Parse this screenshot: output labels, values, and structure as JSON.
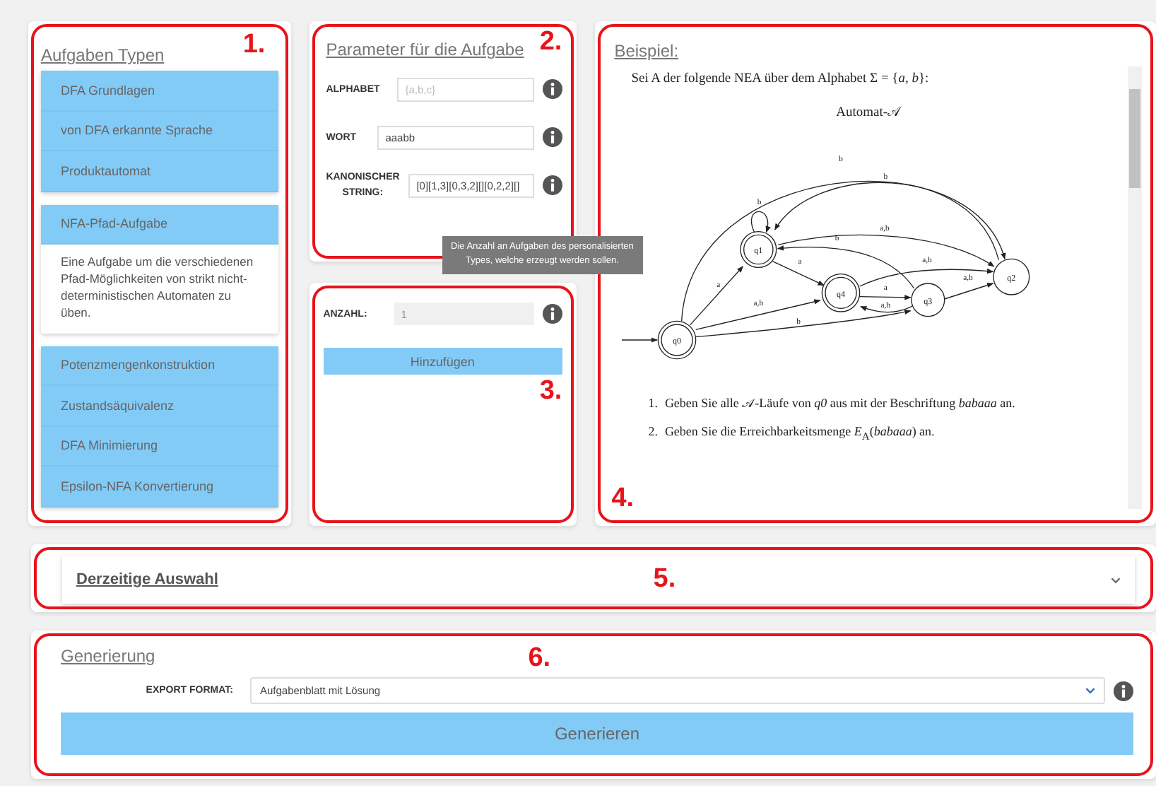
{
  "task_types": {
    "heading": "Aufgaben Typen",
    "annotation": "1.",
    "groups": [
      {
        "items": [
          {
            "label": "DFA Grundlagen"
          },
          {
            "label": "von DFA erkannte Sprache"
          },
          {
            "label": "Produktautomat"
          }
        ]
      },
      {
        "items": [
          {
            "label": "NFA-Pfad-Aufgabe",
            "description": "Eine Aufgabe um die verschiedenen Pfad-Möglichkeiten von strikt nicht-deterministischen Automaten zu üben."
          }
        ]
      },
      {
        "items": [
          {
            "label": "Potenzmengenkonstruktion"
          },
          {
            "label": "Zustandsäquivalenz"
          },
          {
            "label": "DFA Minimierung"
          },
          {
            "label": "Epsilon-NFA Konvertierung"
          }
        ]
      }
    ]
  },
  "parameters": {
    "heading": "Parameter für die Aufgabe",
    "annotation": "2.",
    "fields": [
      {
        "label": "ALPHABET",
        "placeholder": "{a,b,c}"
      },
      {
        "label": "WORT",
        "value": "aaabb"
      },
      {
        "label": "KANONISCHER STRING:",
        "value": "[0][1,3][0,3,2][][0,2,2][]"
      }
    ]
  },
  "count": {
    "label": "ANZAHL:",
    "value": "1",
    "disabled": true,
    "tooltip": "Die Anzahl an Aufgaben des personalisierten Types, welche erzeugt werden sollen.",
    "button": "Hinzufügen",
    "annotation": "3."
  },
  "example": {
    "heading": "Beispiel:",
    "annotation": "4.",
    "intro": "Sei A der folgende NEA über dem Alphabet Σ = {*a*, *b*}:",
    "caption": "Automat-𝒜",
    "states": [
      {
        "name": "q0",
        "accepting": true,
        "initial": true
      },
      {
        "name": "q1",
        "accepting": true,
        "initial": false
      },
      {
        "name": "q4",
        "accepting": true,
        "initial": false
      },
      {
        "name": "q3",
        "accepting": false,
        "initial": false
      },
      {
        "name": "q2",
        "accepting": false,
        "initial": false
      }
    ],
    "transitions": [
      {
        "label": "a"
      },
      {
        "label": "a,b"
      },
      {
        "label": "b"
      },
      {
        "label": "b"
      },
      {
        "label": "b"
      },
      {
        "label": "b"
      },
      {
        "label": "a,b"
      },
      {
        "label": "b"
      },
      {
        "label": "a"
      },
      {
        "label": "a,b"
      },
      {
        "label": "a"
      },
      {
        "label": "a,b"
      },
      {
        "label": "a,b"
      }
    ],
    "tasks": [
      {
        "number": "1.",
        "text": "Geben Sie alle 𝒜-Läufe von *q0* aus mit der Beschriftung *babaaa* an."
      },
      {
        "number": "2.",
        "text": "Geben Sie die Erreichbarkeitsmenge *E*$_{A}$(*babaaa*) an."
      }
    ]
  },
  "selection": {
    "heading": "Derzeitige Auswahl",
    "expanded": false,
    "annotation": "5."
  },
  "generation": {
    "heading": "Generierung",
    "annotation": "6.",
    "label": "EXPORT FORMAT:",
    "value": "Aufgabenblatt mit Lösung",
    "button": "Generieren"
  }
}
